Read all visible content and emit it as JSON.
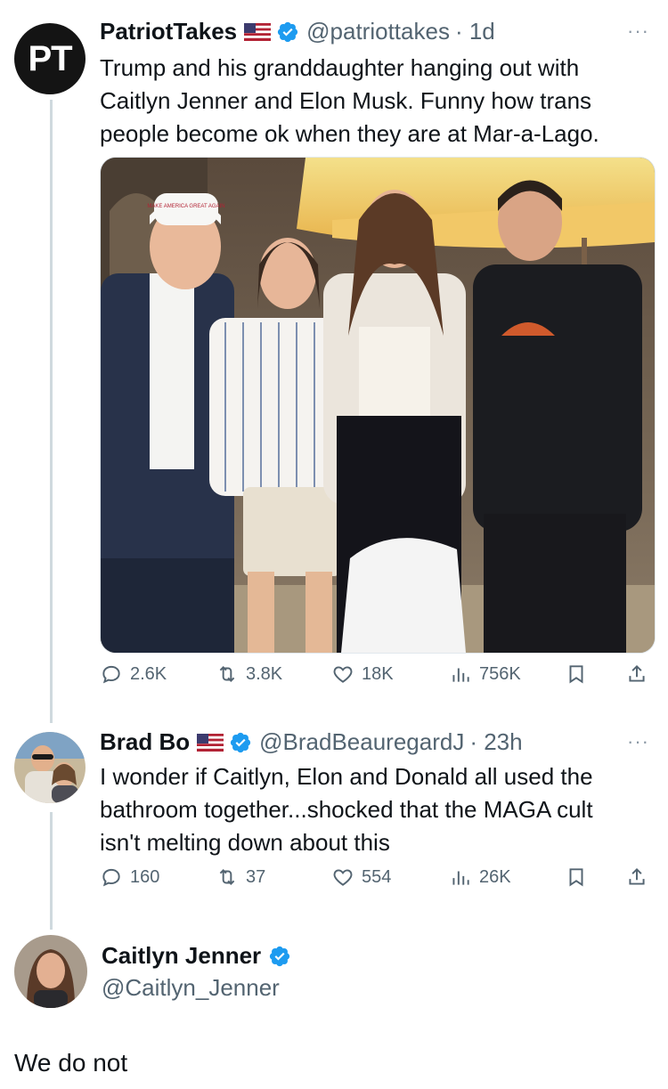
{
  "tweet": {
    "avatar_text": "PT",
    "name": "PatriotTakes",
    "handle": "@patriottakes",
    "time": "· 1d",
    "lines": [
      "Trump and his granddaughter hanging out with",
      "Caitlyn Jenner and Elon Musk. Funny how trans",
      "people become ok when they are at Mar-a-Lago."
    ],
    "stats": {
      "replies": "2.6K",
      "reposts": "3.8K",
      "likes": "18K",
      "views": "756K"
    },
    "hat_text": "MAKE AMERICA GREAT AGAIN"
  },
  "reply": {
    "name": "Brad Bo",
    "handle": "@BradBeauregardJ",
    "time": "· 23h",
    "lines": [
      "I wonder if Caitlyn, Elon and Donald all used the",
      "bathroom together...shocked that the MAGA cult",
      "isn't melting down about this"
    ],
    "stats": {
      "replies": "160",
      "reposts": "37",
      "likes": "554",
      "views": "26K"
    }
  },
  "composer": {
    "name": "Caitlyn Jenner",
    "handle": "@Caitlyn_Jenner",
    "text": "We do not"
  },
  "colors": {
    "verified": "#1d9bf0",
    "muted": "#536471",
    "thread": "#cfd9de"
  }
}
